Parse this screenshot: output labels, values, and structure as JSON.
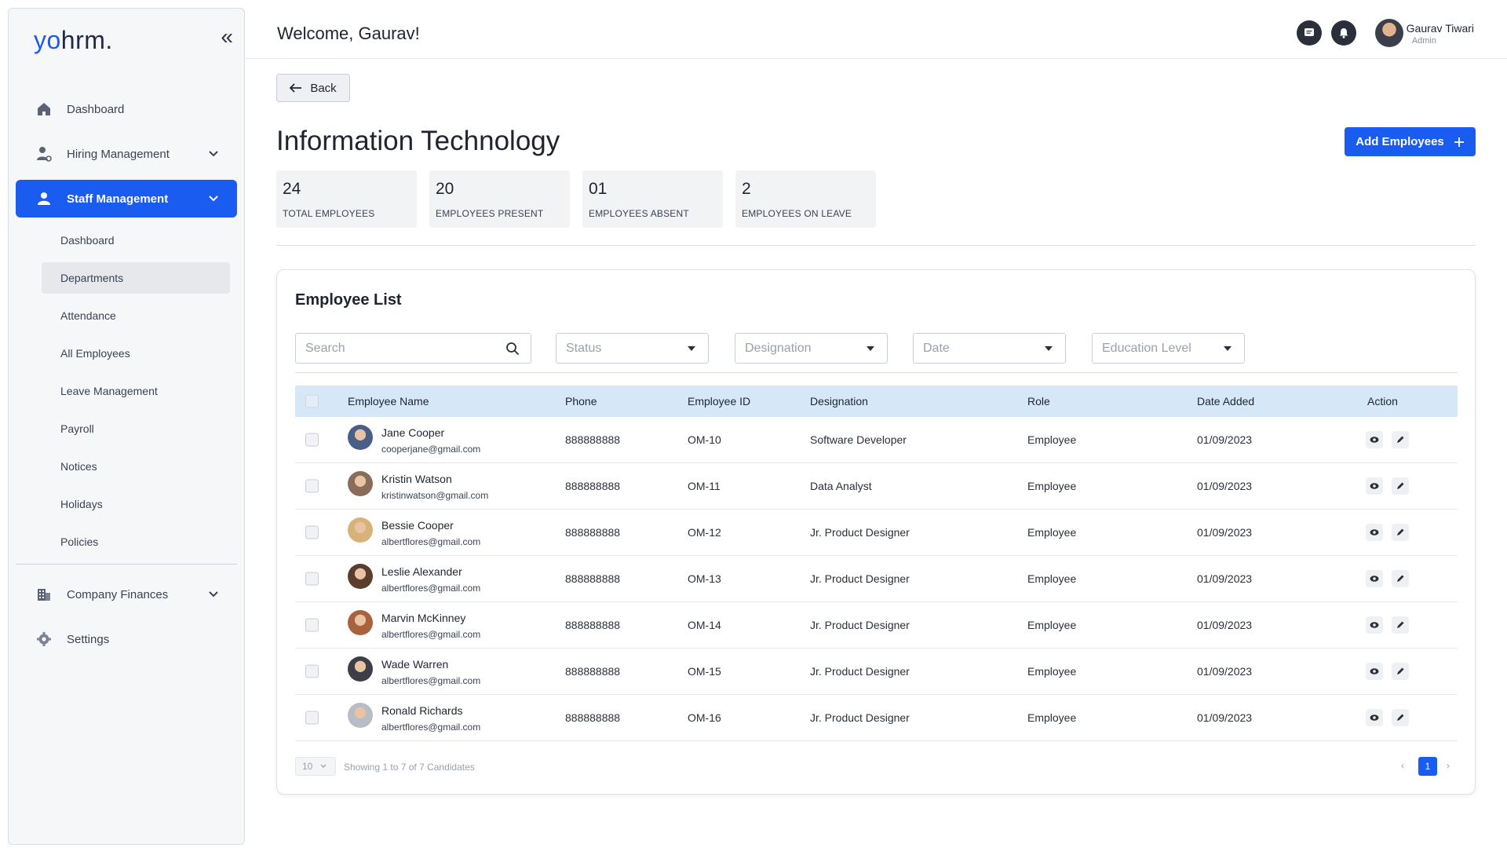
{
  "app": {
    "logo_part1": "yo",
    "logo_part2": "hrm."
  },
  "sidebar": {
    "items": [
      {
        "label": "Dashboard",
        "icon": "home-icon"
      },
      {
        "label": "Hiring Management",
        "icon": "users-gear-icon"
      },
      {
        "label": "Staff Management",
        "icon": "user-icon"
      }
    ],
    "sub_items": [
      "Dashboard",
      "Departments",
      "Attendance",
      "All Employees",
      "Leave Management",
      "Payroll",
      "Notices",
      "Holidays",
      "Policies"
    ],
    "bottom_items": [
      {
        "label": "Company Finances",
        "icon": "building-icon"
      },
      {
        "label": "Settings",
        "icon": "gear-icon"
      }
    ]
  },
  "header": {
    "welcome": "Welcome,  Gaurav!",
    "user_name": "Gaurav Tiwari",
    "user_role": "Admin"
  },
  "main": {
    "back_label": "Back",
    "title": "Information Technology",
    "add_label": "Add Employees",
    "stats": [
      {
        "value": "24",
        "label": "TOTAL EMPLOYEES"
      },
      {
        "value": "20",
        "label": "EMPLOYEES PRESENT"
      },
      {
        "value": "01",
        "label": "EMPLOYEES ABSENT"
      },
      {
        "value": "2",
        "label": "EMPLOYEES ON LEAVE"
      }
    ]
  },
  "list": {
    "title": "Employee List",
    "search_placeholder": "Search",
    "filters": [
      "Status",
      "Designation",
      "Date",
      "Education Level"
    ],
    "columns": [
      "Employee Name",
      "Phone",
      "Employee ID",
      "Designation",
      "Role",
      "Date Added",
      "Action"
    ],
    "rows": [
      {
        "name": "Jane Cooper",
        "email": "cooperjane@gmail.com",
        "phone": "888888888",
        "id": "OM-10",
        "designation": "Software Developer",
        "role": "Employee",
        "date": "01/09/2023"
      },
      {
        "name": "Kristin Watson",
        "email": "kristinwatson@gmail.com",
        "phone": "888888888",
        "id": "OM-11",
        "designation": "Data Analyst",
        "role": "Employee",
        "date": "01/09/2023"
      },
      {
        "name": "Bessie Cooper",
        "email": "albertflores@gmail.com",
        "phone": "888888888",
        "id": "OM-12",
        "designation": "Jr. Product Designer",
        "role": "Employee",
        "date": "01/09/2023"
      },
      {
        "name": "Leslie Alexander",
        "email": "albertflores@gmail.com",
        "phone": "888888888",
        "id": "OM-13",
        "designation": "Jr. Product Designer",
        "role": "Employee",
        "date": "01/09/2023"
      },
      {
        "name": "Marvin McKinney",
        "email": "albertflores@gmail.com",
        "phone": "888888888",
        "id": "OM-14",
        "designation": "Jr. Product Designer",
        "role": "Employee",
        "date": "01/09/2023"
      },
      {
        "name": "Wade Warren",
        "email": "albertflores@gmail.com",
        "phone": "888888888",
        "id": "OM-15",
        "designation": "Jr. Product Designer",
        "role": "Employee",
        "date": "01/09/2023"
      },
      {
        "name": "Ronald Richards",
        "email": "albertflores@gmail.com",
        "phone": "888888888",
        "id": "OM-16",
        "designation": "Jr. Product Designer",
        "role": "Employee",
        "date": "01/09/2023"
      }
    ],
    "per_page": "10",
    "showing": "Showing 1 to 7 of 7 Candidates",
    "page": "1",
    "avatar_colors": [
      "#4a5f88",
      "#8a6c5a",
      "#d9b27a",
      "#5b3d2e",
      "#a8623e",
      "#3c3f48",
      "#b8bcc4"
    ]
  }
}
